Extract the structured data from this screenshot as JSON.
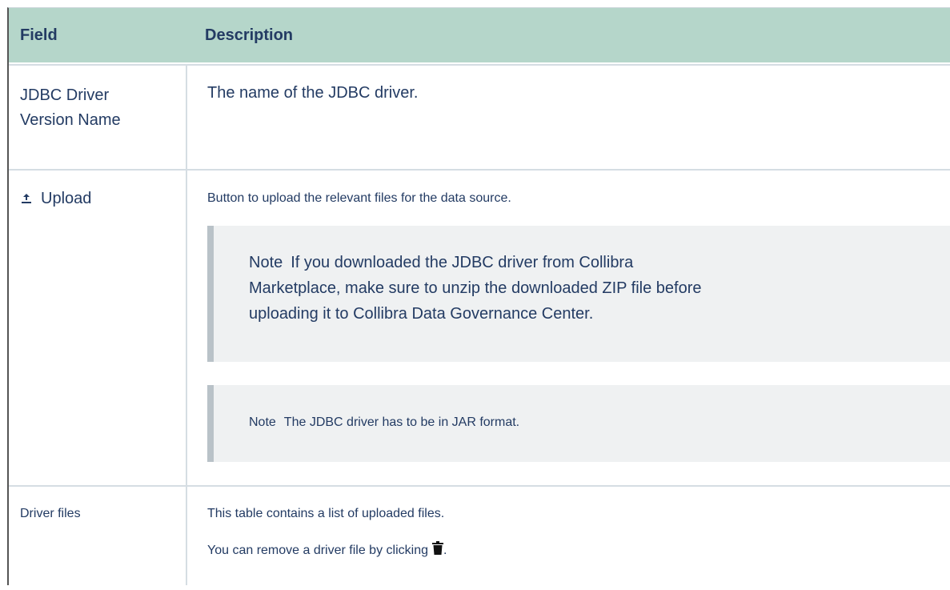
{
  "table": {
    "headers": [
      "Field",
      "Description"
    ],
    "rows": [
      {
        "field": "JDBC Driver Version Name",
        "field_line1": "JDBC Driver",
        "field_line2": "Version Name",
        "description": "The name of the JDBC driver."
      },
      {
        "field": "Upload",
        "icon": "upload-icon",
        "description": "Button to upload the relevant files for the data source.",
        "notes": [
          {
            "label": "Note",
            "line1": "If you downloaded the JDBC driver from Collibra",
            "line2": "Marketplace, make sure to unzip the downloaded ZIP file before",
            "line3": "uploading it to Collibra Data Governance Center."
          },
          {
            "label": "Note",
            "text": "The JDBC driver has to be in JAR format."
          }
        ]
      },
      {
        "field": "Driver files",
        "description_line1": "This table contains a list of uploaded files.",
        "description_line2": "You can remove a driver file by clicking",
        "description_suffix": ".",
        "icon": "trash-icon"
      }
    ]
  },
  "colors": {
    "header_bg": "#b5d6ca",
    "text": "#233b63",
    "note_bg": "#eff1f2",
    "note_border": "#b9c2c8"
  }
}
